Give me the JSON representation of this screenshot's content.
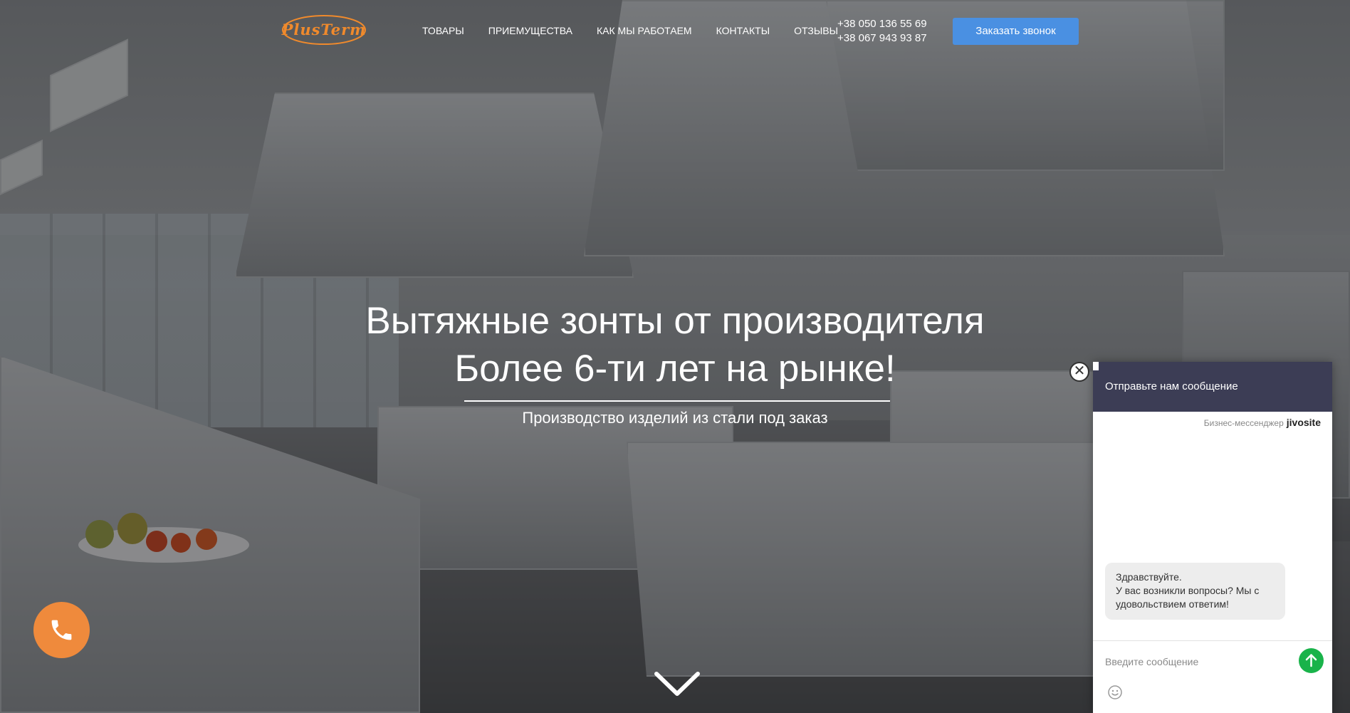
{
  "header": {
    "logo_text": "PlusTerm",
    "nav": [
      {
        "label": "ТОВАРЫ"
      },
      {
        "label": "ПРИЕМУЩЕСТВА"
      },
      {
        "label": "КАК МЫ РАБОТАЕМ"
      },
      {
        "label": "КОНТАКТЫ"
      },
      {
        "label": "ОТЗЫВЫ"
      }
    ],
    "phones": [
      "+38 050 136 55 69",
      "+38 067 943 93 87"
    ],
    "callback_label": "Заказать звонок"
  },
  "hero": {
    "title_line1": "Вытяжные зонты от производителя",
    "title_line2": "Более 6-ти лет на рынке!",
    "subtitle": "Производство изделий из стали под заказ"
  },
  "chat": {
    "header_title": "Отправьте нам сообщение",
    "brand_prefix": "Бизнес-мессенджер",
    "brand_name": "jivosite",
    "message_line1": "Здравствуйте.",
    "message_line2": "У вас возникли вопросы? Мы с удовольствием ответим!",
    "input_placeholder": "Введите сообщение",
    "close_symbol": "✕"
  },
  "colors": {
    "accent": "#4a90e2",
    "logo": "#f08a2c",
    "phone_bubble": "#ef8a3c",
    "chat_header": "#3c3d55",
    "send_button": "#19b34a"
  },
  "icons": {
    "phone_bubble": "phone-icon",
    "scroll": "chevron-down-icon",
    "send": "arrow-up-icon",
    "emoji": "smiley-icon",
    "close": "close-icon"
  }
}
